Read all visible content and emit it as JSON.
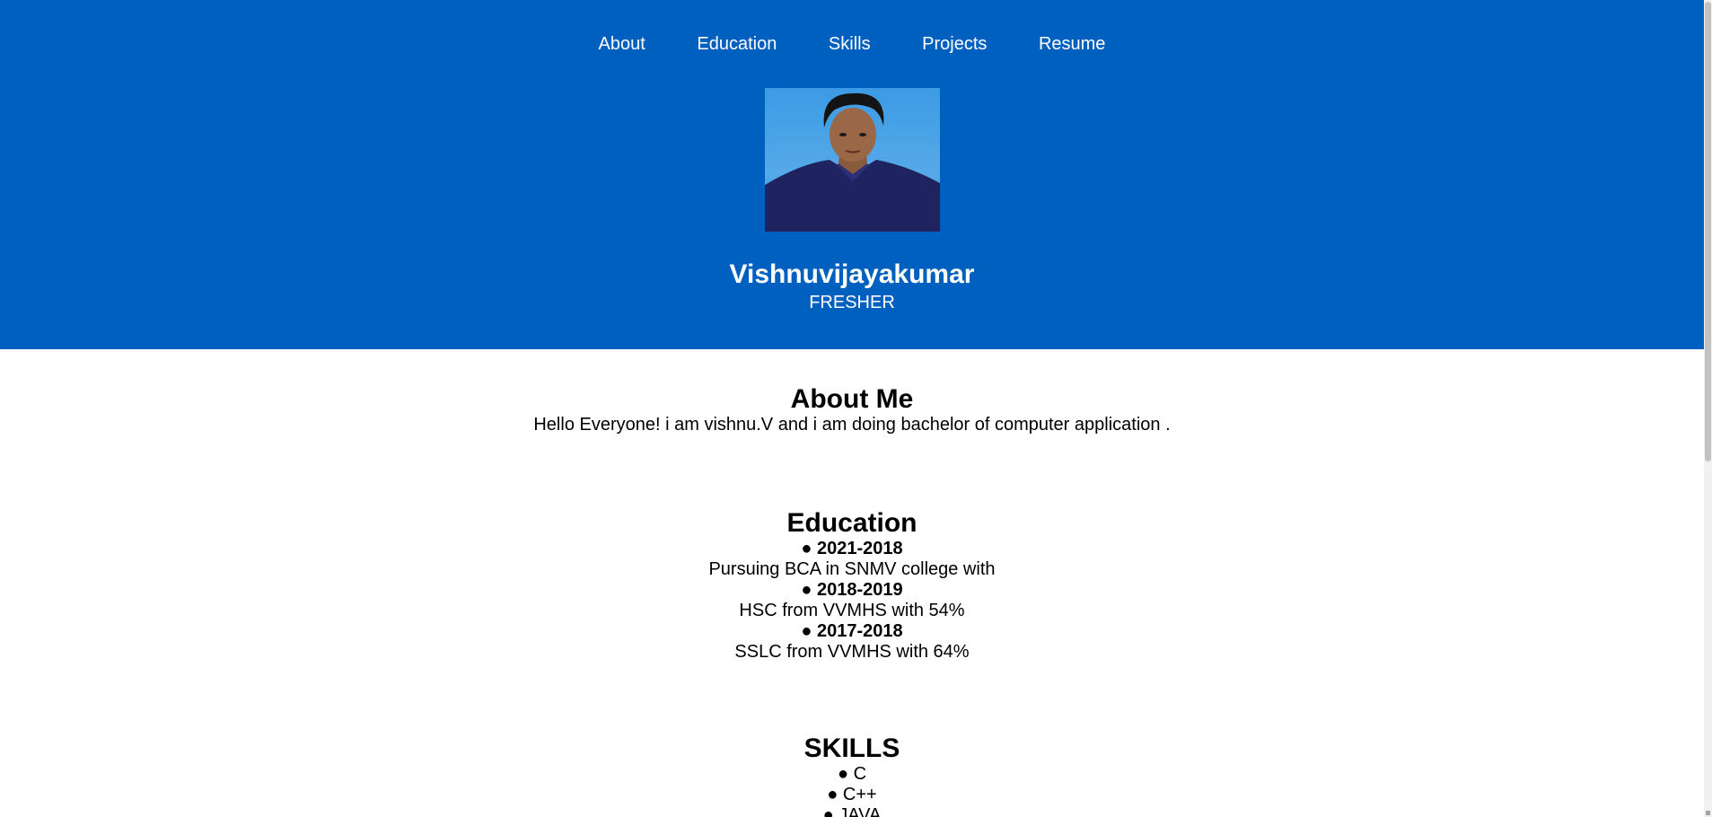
{
  "nav": {
    "items": [
      {
        "label": "About"
      },
      {
        "label": "Education"
      },
      {
        "label": "Skills"
      },
      {
        "label": "Projects"
      },
      {
        "label": "Resume"
      }
    ]
  },
  "profile": {
    "name": "Vishnuvijayakumar",
    "role": "FRESHER"
  },
  "about": {
    "heading": "About Me",
    "text": "Hello Everyone! i am vishnu.V and i am doing bachelor of computer application ."
  },
  "education": {
    "heading": "Education",
    "entries": [
      {
        "bullet": "●",
        "years": "2021-2018",
        "detail": "Pursuing BCA in SNMV college with"
      },
      {
        "bullet": "●",
        "years": "2018-2019",
        "detail": "HSC from VVMHS with 54%"
      },
      {
        "bullet": "●",
        "years": "2017-2018",
        "detail": "SSLC from VVMHS with 64%"
      }
    ]
  },
  "skills": {
    "heading": "SKILLS",
    "items": [
      {
        "bullet": "●",
        "label": "C"
      },
      {
        "bullet": "●",
        "label": "C++"
      },
      {
        "bullet": "●",
        "label": "JAVA"
      }
    ]
  },
  "colors": {
    "hero_background": "#0060bf",
    "text": "#000000"
  }
}
